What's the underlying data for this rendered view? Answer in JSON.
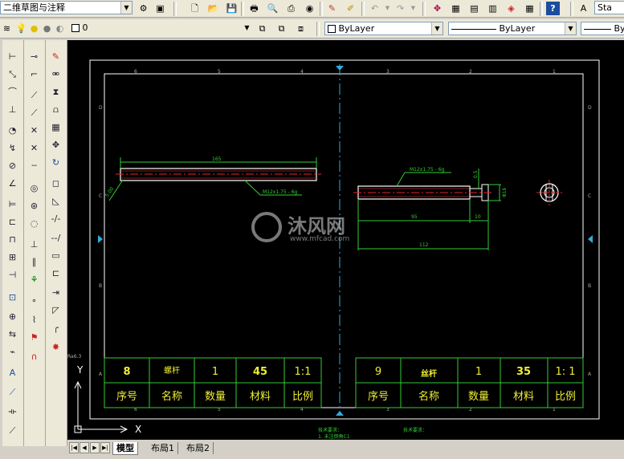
{
  "workspace": {
    "value": "二维草图与注释"
  },
  "toolbar2": {
    "layer_value": "0",
    "color_value": "ByLayer",
    "linetype_value": "ByLayer",
    "lineweight_value": "ByLayer",
    "style_partial": "Sta"
  },
  "drawing": {
    "shaft_dims": {
      "length": "165",
      "thread": "M12x1.75 - 6g",
      "edge": "5.00"
    },
    "right_dims": {
      "thread": "M12x1.75 - 6g",
      "d1": "95",
      "d2": "10",
      "d3": "112",
      "h": "0.5",
      "dia": "Φ16"
    },
    "title_left": {
      "no": "8",
      "name": "螺杆",
      "qty": "1",
      "mat": "45",
      "scale": "1:1"
    },
    "title_right": {
      "no": "9",
      "name": "丝杆",
      "qty": "1",
      "mat": "35",
      "scale": "1: 1"
    },
    "headers": {
      "no": "序号",
      "name": "名称",
      "qty": "数量",
      "mat": "材料",
      "scale": "比例"
    },
    "zone_top": [
      "6",
      "5",
      "4",
      "3",
      "2",
      "1"
    ],
    "zone_side": [
      "D",
      "C",
      "B",
      "A"
    ],
    "note_left": "技术要求：",
    "note_left2": "1. 未注倒角C1",
    "note_right": "技术要求：",
    "ra": "Ra6.3"
  },
  "watermark": {
    "brand": "沐风网",
    "url": "www.mfcad.com"
  },
  "ucs": {
    "y": "Y",
    "x": "X"
  },
  "tabs": {
    "model": "模型",
    "layout1": "布局1",
    "layout2": "布局2"
  }
}
